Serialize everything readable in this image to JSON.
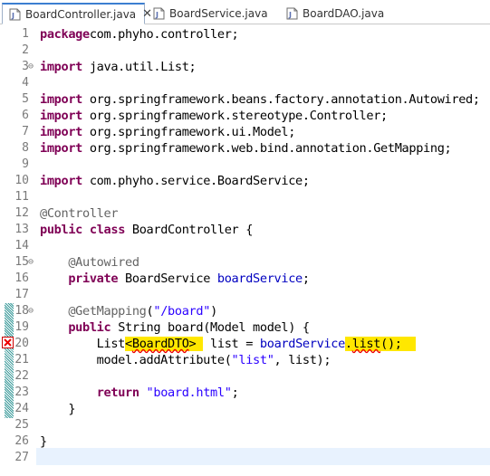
{
  "tabs": [
    {
      "label": "BoardController.java",
      "active": true,
      "close": "✕"
    },
    {
      "label": "BoardService.java",
      "active": false
    },
    {
      "label": "BoardDAO.java",
      "active": false
    }
  ],
  "colors": {
    "keyword": "#7f0055",
    "annotation": "#646464",
    "string": "#2a00ff",
    "field": "#0000c0",
    "highlight": "#ffe700",
    "current_line": "#e8f2fe"
  },
  "lines": [
    {
      "n": "1",
      "tokens": [
        [
          "kw",
          "package"
        ],
        [
          "",
          "com.phyho.controller;"
        ]
      ]
    },
    {
      "n": "2",
      "tokens": []
    },
    {
      "n": "3",
      "fold": true,
      "tokens": [
        [
          "kw",
          "import"
        ],
        [
          "",
          " java.util.List;"
        ]
      ]
    },
    {
      "n": "4",
      "tokens": []
    },
    {
      "n": "5",
      "tokens": [
        [
          "kw",
          "import"
        ],
        [
          "",
          " org.springframework.beans.factory.annotation.Autowired;"
        ]
      ]
    },
    {
      "n": "6",
      "tokens": [
        [
          "kw",
          "import"
        ],
        [
          "",
          " org.springframework.stereotype.Controller;"
        ]
      ]
    },
    {
      "n": "7",
      "tokens": [
        [
          "kw",
          "import"
        ],
        [
          "",
          " org.springframework.ui.Model;"
        ]
      ]
    },
    {
      "n": "8",
      "tokens": [
        [
          "kw",
          "import"
        ],
        [
          "",
          " org.springframework.web.bind.annotation.GetMapping;"
        ]
      ]
    },
    {
      "n": "9",
      "tokens": []
    },
    {
      "n": "10",
      "tokens": [
        [
          "kw",
          "import"
        ],
        [
          "",
          " com.phyho.service.BoardService;"
        ]
      ]
    },
    {
      "n": "11",
      "tokens": []
    },
    {
      "n": "12",
      "tokens": [
        [
          "ann",
          "@Controller"
        ]
      ]
    },
    {
      "n": "13",
      "tokens": [
        [
          "kw",
          "public"
        ],
        [
          "",
          " "
        ],
        [
          "kw",
          "class"
        ],
        [
          "",
          " BoardController {"
        ]
      ]
    },
    {
      "n": "14",
      "tokens": []
    },
    {
      "n": "15",
      "fold": true,
      "tokens": [
        [
          "",
          "    "
        ],
        [
          "ann",
          "@Autowired"
        ]
      ]
    },
    {
      "n": "16",
      "tokens": [
        [
          "",
          "    "
        ],
        [
          "kw",
          "private"
        ],
        [
          "",
          " BoardService "
        ],
        [
          "fld",
          "boardService"
        ],
        [
          "",
          ";"
        ]
      ]
    },
    {
      "n": "17",
      "tokens": []
    },
    {
      "n": "18",
      "fold": true,
      "tokens": [
        [
          "",
          "    "
        ],
        [
          "ann",
          "@GetMapping"
        ],
        [
          "",
          "("
        ],
        [
          "str",
          "\"/board\""
        ],
        [
          "",
          ")"
        ]
      ]
    },
    {
      "n": "19",
      "tokens": [
        [
          "",
          "    "
        ],
        [
          "kw",
          "public"
        ],
        [
          "",
          " String board(Model model) {"
        ]
      ]
    },
    {
      "n": "20",
      "tokens": [
        [
          "",
          "        List"
        ],
        [
          "hl",
          "<"
        ],
        [
          "hl err",
          "BoardDTO"
        ],
        [
          "hl",
          "> "
        ],
        [
          "",
          " list = "
        ],
        [
          "fld",
          "boardService"
        ],
        [
          "hl",
          "."
        ],
        [
          "hl err",
          "list"
        ],
        [
          "hl",
          "();  "
        ]
      ]
    },
    {
      "n": "21",
      "tokens": [
        [
          "",
          "        model.addAttribute("
        ],
        [
          "str",
          "\"list\""
        ],
        [
          "",
          ", list);"
        ]
      ]
    },
    {
      "n": "22",
      "tokens": []
    },
    {
      "n": "23",
      "tokens": [
        [
          "",
          "        "
        ],
        [
          "kw",
          "return"
        ],
        [
          "",
          " "
        ],
        [
          "str",
          "\"board.html\""
        ],
        [
          "",
          ";"
        ]
      ]
    },
    {
      "n": "24",
      "tokens": [
        [
          "",
          "    }"
        ]
      ]
    },
    {
      "n": "25",
      "tokens": []
    },
    {
      "n": "26",
      "tokens": [
        [
          "",
          "}"
        ]
      ]
    },
    {
      "n": "27",
      "tokens": []
    }
  ]
}
